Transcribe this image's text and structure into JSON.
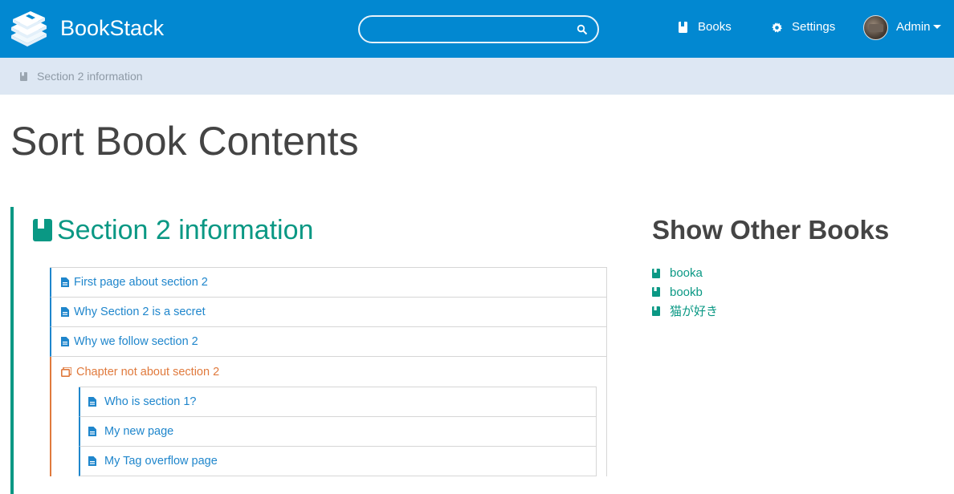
{
  "header": {
    "app_title": "BookStack",
    "search": {
      "value": "",
      "placeholder": ""
    },
    "nav": [
      {
        "label": "Books",
        "icon": "book-icon"
      },
      {
        "label": "Settings",
        "icon": "gear-icon"
      }
    ],
    "user": {
      "name": "Admin"
    }
  },
  "breadcrumb": {
    "label": "Section 2 information"
  },
  "page": {
    "title": "Sort Book Contents"
  },
  "book": {
    "title": "Section 2 information",
    "items": [
      {
        "type": "page",
        "label": "First page about section 2"
      },
      {
        "type": "page",
        "label": "Why Section 2 is a secret"
      },
      {
        "type": "page",
        "label": "Why we follow section 2"
      }
    ],
    "chapter": {
      "label": "Chapter not about section 2",
      "pages": [
        {
          "label": "Who is section 1?"
        },
        {
          "label": "My new page"
        },
        {
          "label": "My Tag overflow page"
        }
      ]
    }
  },
  "sidebar": {
    "title": "Show Other Books",
    "books": [
      "booka",
      "bookb",
      "猫が好き"
    ]
  },
  "colors": {
    "header": "#0288D1",
    "book": "#0a9884",
    "page": "#1f86cc",
    "chapter": "#e07a3d",
    "breadcrumb_bg": "#dde7f3"
  }
}
